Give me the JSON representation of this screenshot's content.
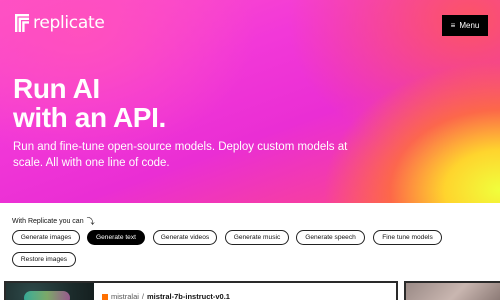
{
  "header": {
    "logo_text": "replicate",
    "menu_label": "Menu",
    "menu_icon": "hamburger-icon"
  },
  "hero": {
    "title_line1": "Run AI",
    "title_line2": "with an API.",
    "subtitle": "Run and fine-tune open-source models. Deploy custom models at scale. All with one line of code."
  },
  "use_cases": {
    "label": "With Replicate you can",
    "arrow_icon": "curved-arrow-icon",
    "chips": [
      {
        "label": "Generate images",
        "active": false
      },
      {
        "label": "Generate text",
        "active": true
      },
      {
        "label": "Generate videos",
        "active": false
      },
      {
        "label": "Generate music",
        "active": false
      },
      {
        "label": "Generate speech",
        "active": false
      },
      {
        "label": "Fine tune models",
        "active": false
      },
      {
        "label": "Restore images",
        "active": false
      }
    ]
  },
  "model_card": {
    "owner": "mistralai",
    "separator": "/",
    "model": "mistral-7b-instruct-v0.1"
  },
  "colors": {
    "hero_pink": "#f238d8",
    "hero_yellow": "#f0ff3c",
    "button_black": "#000000",
    "owner_icon": "#ff7000"
  }
}
